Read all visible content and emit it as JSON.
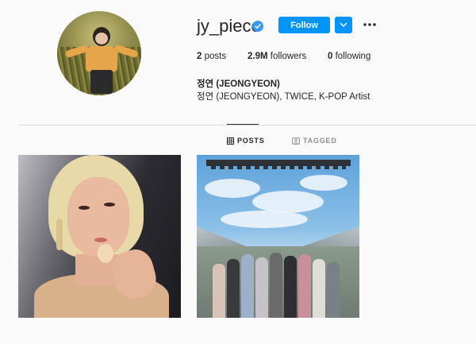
{
  "profile": {
    "username": "jy_piece",
    "verified": true,
    "follow_label": "Follow",
    "full_name": "정연 (JEONGYEON)",
    "bio": "정연 (JEONGYEON), TWICE, K-POP Artist"
  },
  "stats": {
    "posts_count": "2",
    "posts_label": " posts",
    "followers_count": "2.9M",
    "followers_label": " followers",
    "following_count": "0",
    "following_label": " following"
  },
  "tabs": {
    "posts": "POSTS",
    "tagged": "TAGGED"
  },
  "colors": {
    "accent": "#0095f6",
    "verified": "#3897f0"
  },
  "icons": {
    "verified": "verified-badge-icon",
    "dropdown": "chevron-down-icon",
    "more": "more-options-icon",
    "grid": "grid-icon",
    "tagged": "tagged-icon"
  }
}
